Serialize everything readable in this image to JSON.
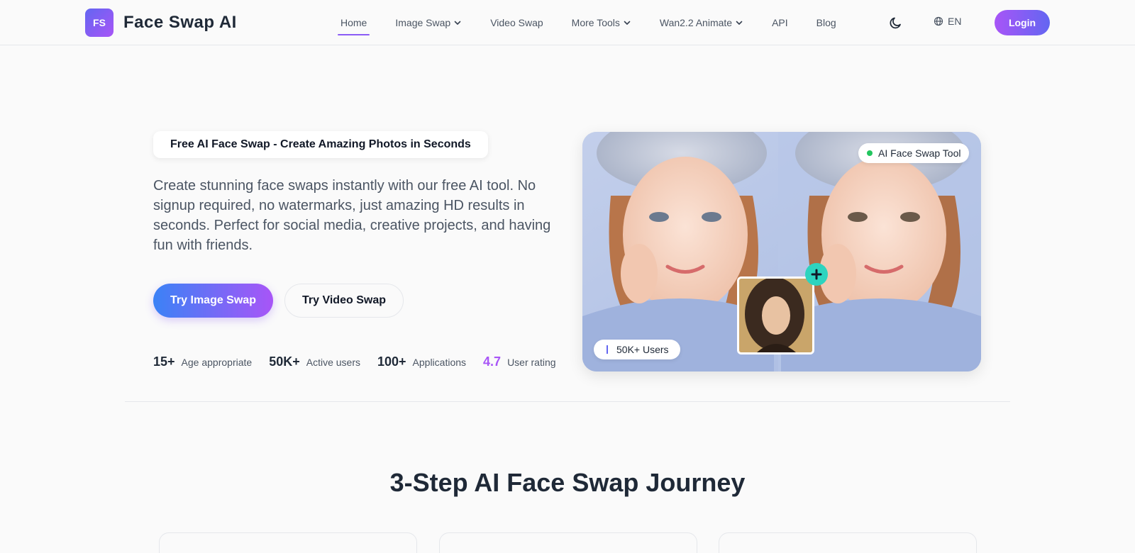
{
  "header": {
    "logo_badge": "FS",
    "logo_text": "Face Swap AI",
    "nav": [
      {
        "label": "Home",
        "dropdown": false,
        "active": true
      },
      {
        "label": "Image Swap",
        "dropdown": true
      },
      {
        "label": "Video Swap",
        "dropdown": false
      },
      {
        "label": "More Tools",
        "dropdown": true
      },
      {
        "label": "Wan2.2 Animate",
        "dropdown": true
      },
      {
        "label": "API",
        "dropdown": false
      },
      {
        "label": "Blog",
        "dropdown": false
      }
    ],
    "theme_icon": "moon-icon",
    "language": "EN",
    "login_label": "Login"
  },
  "hero": {
    "badge": "Free AI Face Swap - Create Amazing Photos in Seconds",
    "description": "Create stunning face swaps instantly with our free AI tool. No signup required, no watermarks, just amazing HD results in seconds. Perfect for social media, creative projects, and having fun with friends.",
    "primary_button": "Try Image Swap",
    "secondary_button": "Try Video Swap",
    "stats": [
      {
        "value": "15+",
        "label": "Age appropriate"
      },
      {
        "value": "50K+",
        "label": "Active users"
      },
      {
        "value": "100+",
        "label": "Applications"
      },
      {
        "value": "4.7",
        "label": "User rating",
        "accent": true
      }
    ],
    "image_tag": "AI Face Swap Tool",
    "users_tag": "50K+ Users"
  },
  "section": {
    "title": "3-Step AI Face Swap Journey"
  },
  "colors": {
    "accent": "#8b5cf6",
    "primary_gradient_start": "#3b82f6",
    "primary_gradient_end": "#a855f7",
    "status_dot": "#22c55e",
    "plus_button": "#2dd4bf"
  }
}
